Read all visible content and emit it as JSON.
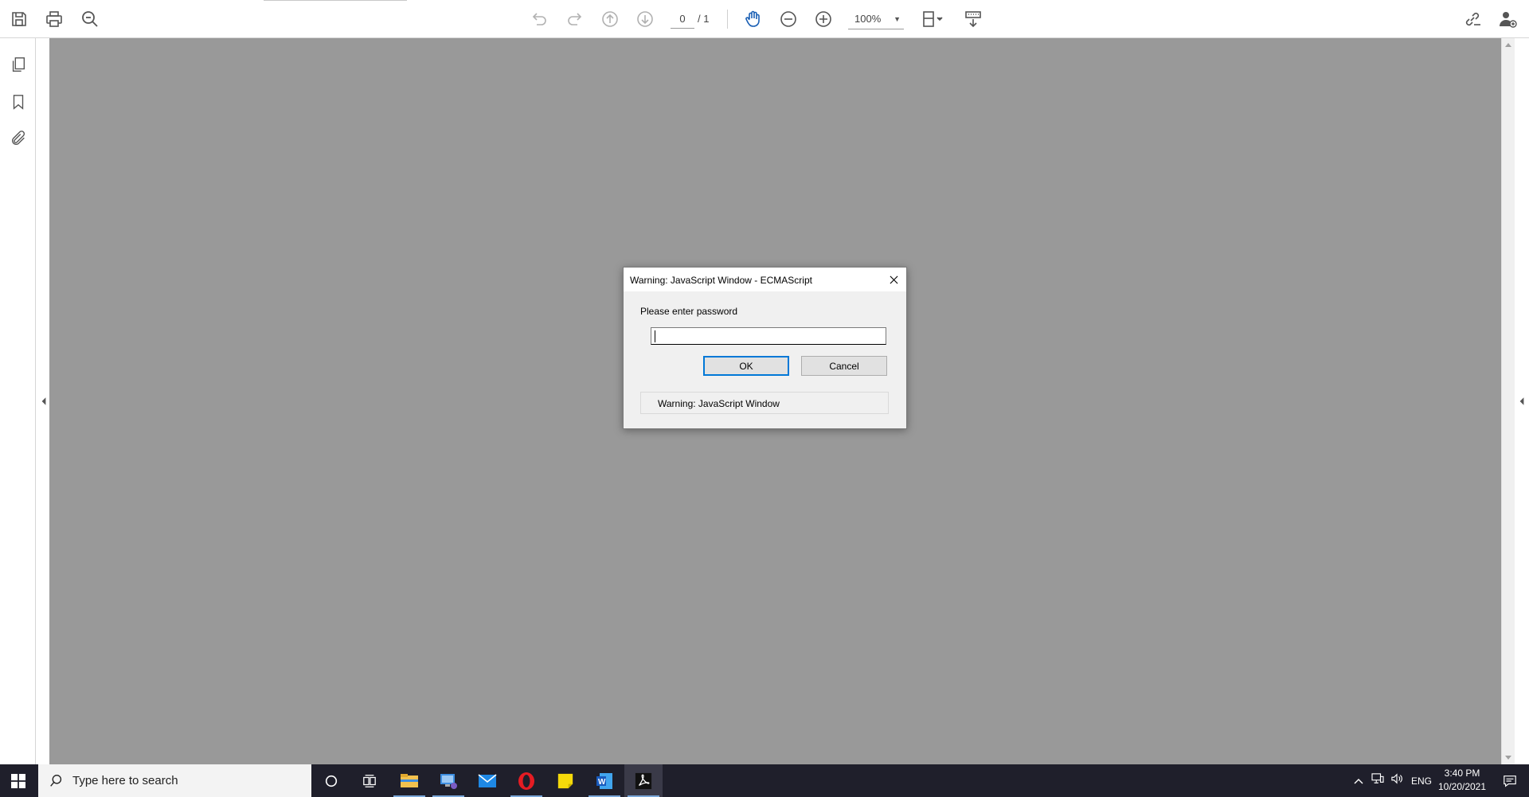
{
  "toolbar": {
    "page_current": "0",
    "page_total": "/ 1",
    "zoom": "100%"
  },
  "dialog": {
    "title": "Warning: JavaScript Window - ECMAScript",
    "prompt": "Please enter password",
    "input_value": "",
    "ok_label": "OK",
    "cancel_label": "Cancel",
    "footer_text": "Warning: JavaScript Window"
  },
  "taskbar": {
    "search_placeholder": "Type here to search",
    "language": "ENG",
    "time": "3:40 PM",
    "date": "10/20/2021",
    "apps": [
      "cortana-icon",
      "task-view-icon",
      "file-explorer-icon",
      "remote-desktop-icon",
      "mail-icon",
      "opera-icon",
      "sticky-notes-icon",
      "word-icon",
      "acrobat-icon"
    ]
  },
  "colors": {
    "doc_background": "#999999",
    "dialog_bg": "#f0f0f0",
    "ok_border": "#0078d7",
    "taskbar_bg": "#1f1f2b"
  }
}
